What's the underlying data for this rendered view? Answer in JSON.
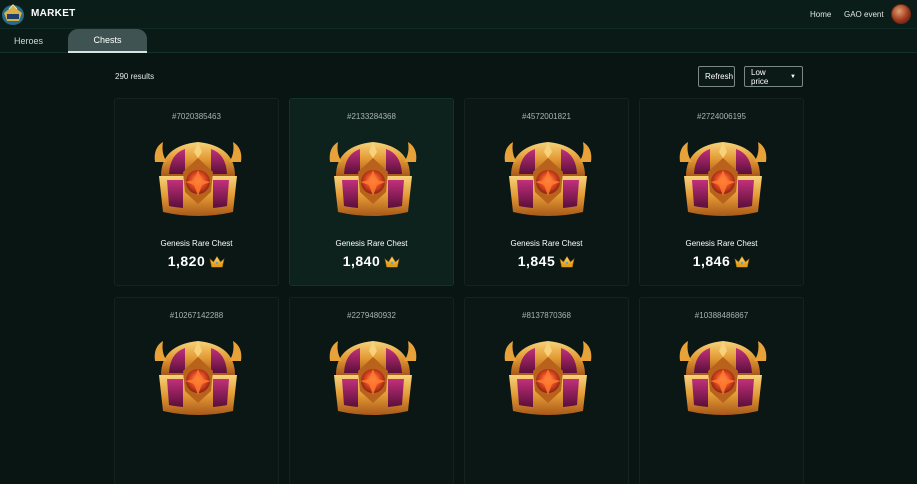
{
  "header": {
    "title": "MARKET",
    "nav": [
      {
        "label": "Home"
      },
      {
        "label": "GAO event"
      }
    ]
  },
  "tabs": [
    {
      "label": "Heroes",
      "active": false
    },
    {
      "label": "Chests",
      "active": true
    }
  ],
  "toolbar": {
    "results_label": "290 results",
    "refresh_label": "Refresh",
    "sort_selected": "Low price"
  },
  "items": [
    {
      "id": "#7020385463",
      "name": "Genesis Rare Chest",
      "price": "1,820"
    },
    {
      "id": "#2133284368",
      "name": "Genesis Rare Chest",
      "price": "1,840"
    },
    {
      "id": "#4572001821",
      "name": "Genesis Rare Chest",
      "price": "1,845"
    },
    {
      "id": "#2724006195",
      "name": "Genesis Rare Chest",
      "price": "1,846"
    },
    {
      "id": "#10267142288",
      "name": "",
      "price": ""
    },
    {
      "id": "#2279480932",
      "name": "",
      "price": ""
    },
    {
      "id": "#8137870368",
      "name": "",
      "price": ""
    },
    {
      "id": "#10388486867",
      "name": "",
      "price": ""
    }
  ],
  "colors": {
    "background": "#081512",
    "header": "#0b1d19",
    "chest_gold": "#e8a23a",
    "chest_purple": "#8a1f5a",
    "crown": "#f2b81c"
  },
  "icons": {
    "logo": "game-logo-icon",
    "avatar": "user-avatar",
    "currency": "crown-icon",
    "sort": "caret-down-icon"
  }
}
